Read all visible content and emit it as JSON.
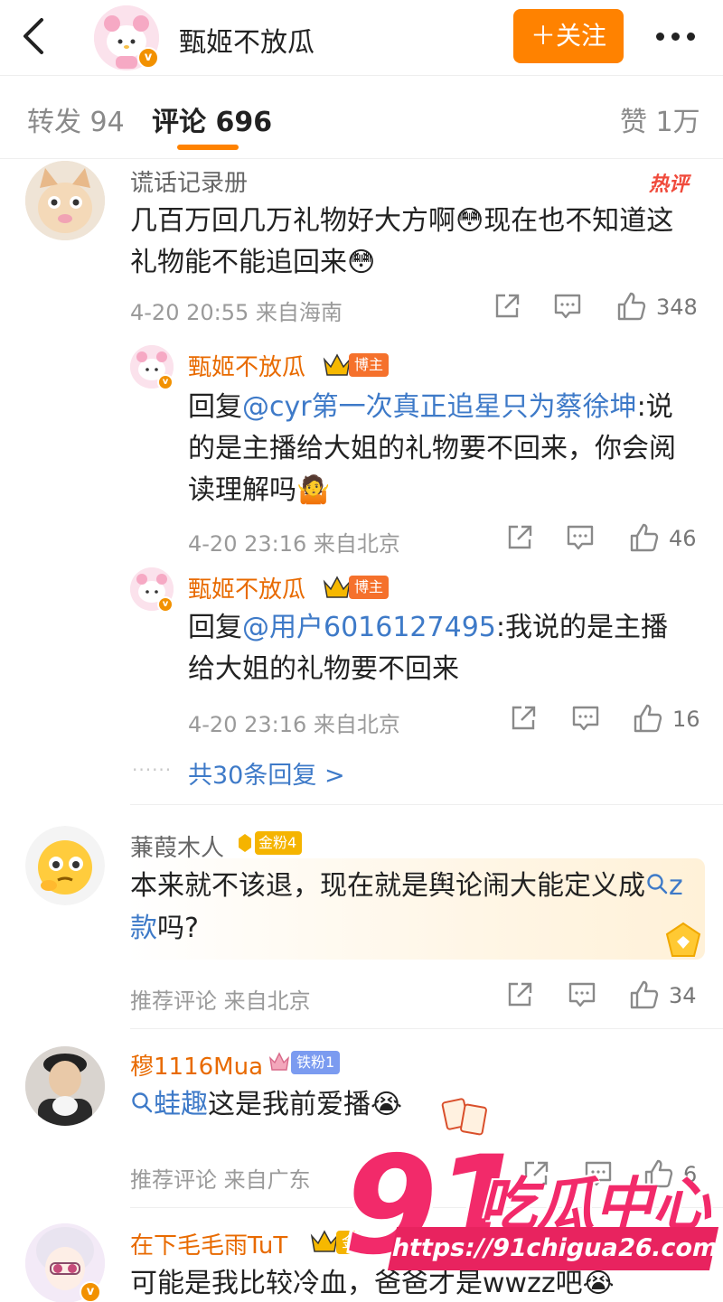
{
  "header": {
    "username": "甄姬不放瓜",
    "follow_label": "＋关注"
  },
  "tabs": [
    {
      "label": "转发 94"
    },
    {
      "label": "评论 696"
    },
    {
      "label": "赞 1万"
    }
  ],
  "comments": [
    {
      "user": "谎话记录册",
      "hot_label": "热评",
      "text": "几百万回几万礼物好大方啊😳现在也不知道这礼物能不能追回来😳",
      "time_location": "4-20 20:55  来自海南",
      "likes": "348",
      "replies": [
        {
          "user": "甄姬不放瓜",
          "badge": "博主",
          "reply_prefix": "回复",
          "mention": "@cyr第一次真正追星只为蔡徐坤",
          "text": ":说的是主播给大姐的礼物要不回来，你会阅读理解吗🤷",
          "time_location": "4-20 23:16  来自北京",
          "likes": "46"
        },
        {
          "user": "甄姬不放瓜",
          "badge": "博主",
          "reply_prefix": "回复",
          "mention": "@用户6016127495",
          "text": ":我说的是主播给大姐的礼物要不回来",
          "time_location": "4-20 23:16  来自北京",
          "likes": "16"
        }
      ],
      "more_replies": "共30条回复 >"
    },
    {
      "user": "蒹葭木人",
      "badge": "金粉4",
      "text_before": "本来就不该退，现在就是舆论闹大能定义成",
      "search_link": "z款",
      "text_after": "吗?",
      "time_location": "推荐评论  来自北京",
      "likes": "34"
    },
    {
      "user": "穆1116Mua",
      "badge": "铁粉1",
      "search_link": "蛙趣",
      "text": "这是我前爱播😭",
      "time_location": "推荐评论  来自广东",
      "likes": "6"
    },
    {
      "user": "在下毛毛雨TuT",
      "badge": "金",
      "text": "可能是我比较冷血，爸爸才是wwzz吧😭"
    }
  ],
  "watermark": {
    "number": "91",
    "brand": "吃瓜中心",
    "url": "https://91chigua26.com"
  },
  "colors": {
    "accent": "#ff8200",
    "link": "#3e7ac8",
    "hot": "#f04a3b",
    "watermark": "#f22a6a"
  }
}
